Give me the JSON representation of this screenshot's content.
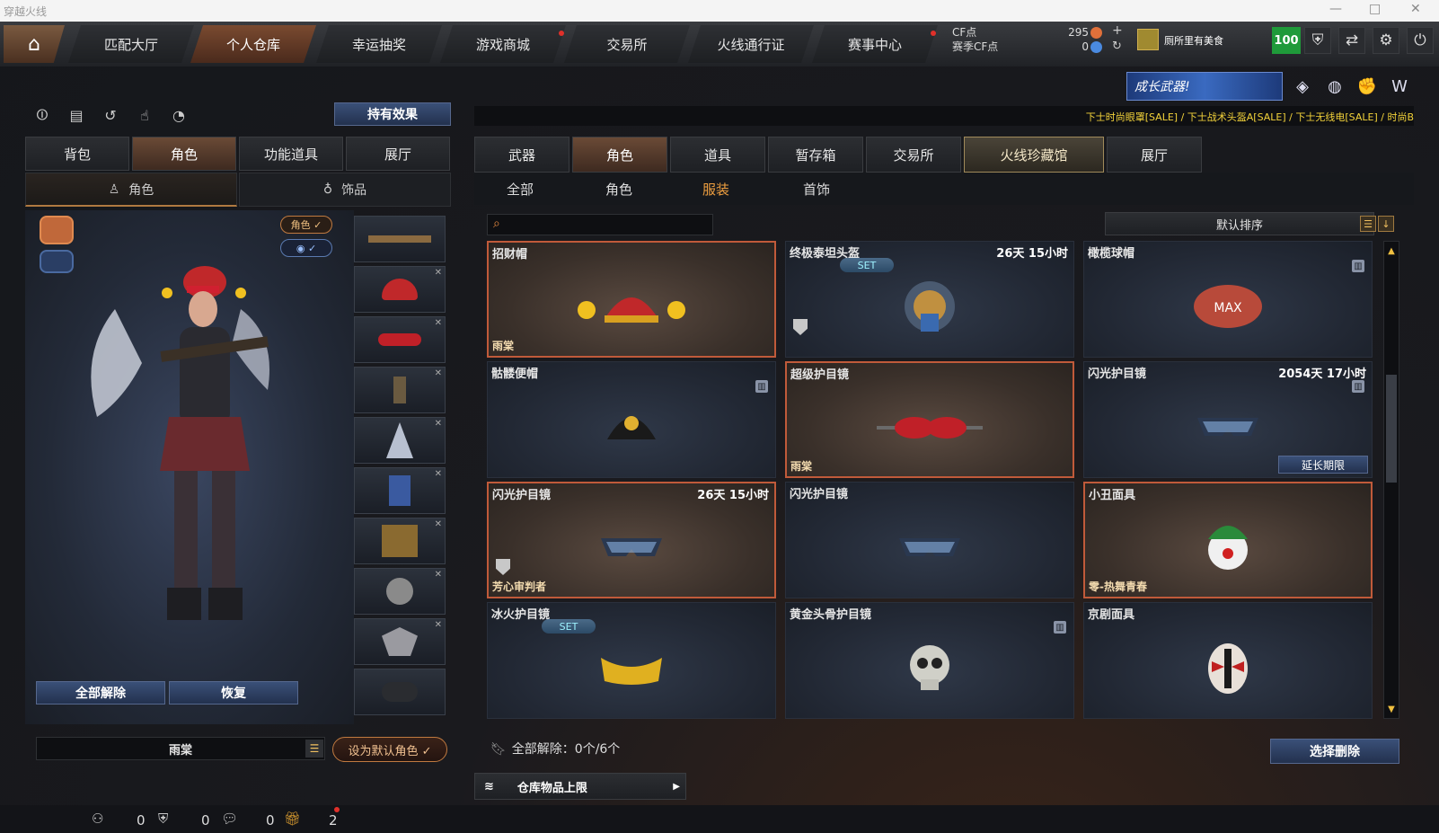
{
  "window": {
    "title": "穿越火线",
    "minimize": "—",
    "maximize": "□",
    "close": "✕"
  },
  "topnav": {
    "home_icon": "home-icon",
    "tabs": [
      {
        "label": "匹配大厅"
      },
      {
        "label": "个人仓库"
      },
      {
        "label": "幸运抽奖"
      },
      {
        "label": "游戏商城"
      },
      {
        "label": "交易所"
      },
      {
        "label": "火线通行证"
      },
      {
        "label": "赛事中心"
      }
    ],
    "cf_label": "CF点",
    "season_cf_label": "赛季CF点",
    "cf_value": "295",
    "season_cf_value": "0",
    "player_name": "厕所里有美食",
    "level": "100"
  },
  "promo": {
    "growth_weapon": "成长武器!"
  },
  "ticker": "下士时尚眼罩[SALE] / 下士战术头盔A[SALE] / 下士无线电[SALE] / 时尚B",
  "left": {
    "hold_effect": "持有效果",
    "tabs": [
      "背包",
      "角色",
      "功能道具",
      "展厅"
    ],
    "subtabs": [
      "角色",
      "饰品"
    ],
    "role_pill": "角色 ✓",
    "eye_pill": "◉ ✓",
    "unequip_all": "全部解除",
    "restore": "恢复",
    "character_name": "雨棠",
    "set_default": "设为默认角色 ✓"
  },
  "right": {
    "tabs": [
      "武器",
      "角色",
      "道具",
      "暂存箱",
      "交易所",
      "火线珍藏馆",
      "展厅"
    ],
    "subtabs": [
      "全部",
      "角色",
      "服装",
      "首饰"
    ],
    "sort_label": "默认排序",
    "items": [
      {
        "name": "招财帽",
        "time": "",
        "tag": "雨棠",
        "set": false,
        "trash": false,
        "shield": false,
        "selected": true,
        "extend": false
      },
      {
        "name": "终极泰坦头盔",
        "time": "26天 15小时",
        "tag": "",
        "set": true,
        "trash": false,
        "shield": true,
        "selected": false,
        "extend": false
      },
      {
        "name": "橄榄球帽",
        "time": "",
        "tag": "",
        "set": false,
        "trash": true,
        "shield": false,
        "selected": false,
        "extend": false
      },
      {
        "name": "骷髅便帽",
        "time": "",
        "tag": "",
        "set": false,
        "trash": true,
        "shield": false,
        "selected": false,
        "extend": false
      },
      {
        "name": "超级护目镜",
        "time": "",
        "tag": "雨棠",
        "set": false,
        "trash": false,
        "shield": false,
        "selected": true,
        "extend": false
      },
      {
        "name": "闪光护目镜",
        "time": "2054天 17小时",
        "tag": "",
        "set": false,
        "trash": true,
        "shield": false,
        "selected": false,
        "extend": true
      },
      {
        "name": "闪光护目镜",
        "time": "26天 15小时",
        "tag": "芳心审判者",
        "set": false,
        "trash": false,
        "shield": true,
        "selected": true,
        "extend": false
      },
      {
        "name": "闪光护目镜",
        "time": "",
        "tag": "",
        "set": false,
        "trash": false,
        "shield": false,
        "selected": false,
        "extend": false
      },
      {
        "name": "小丑面具",
        "time": "",
        "tag": "零-热舞青春",
        "set": false,
        "trash": false,
        "shield": false,
        "selected": true,
        "extend": false
      },
      {
        "name": "冰火护目镜",
        "time": "",
        "tag": "",
        "set": true,
        "trash": false,
        "shield": false,
        "selected": false,
        "extend": false
      },
      {
        "name": "黄金头骨护目镜",
        "time": "",
        "tag": "",
        "set": false,
        "trash": true,
        "shield": false,
        "selected": false,
        "extend": false
      },
      {
        "name": "京剧面具",
        "time": "",
        "tag": "",
        "set": false,
        "trash": false,
        "shield": false,
        "selected": false,
        "extend": false
      }
    ],
    "set_label": "SET",
    "extend_label": "延长期限",
    "unequip_status": "全部解除：0个/6个",
    "select_delete": "选择删除",
    "capacity": "仓库物品上限"
  },
  "status": {
    "v1": "0",
    "v2": "0",
    "v3": "0",
    "v4": "2"
  }
}
